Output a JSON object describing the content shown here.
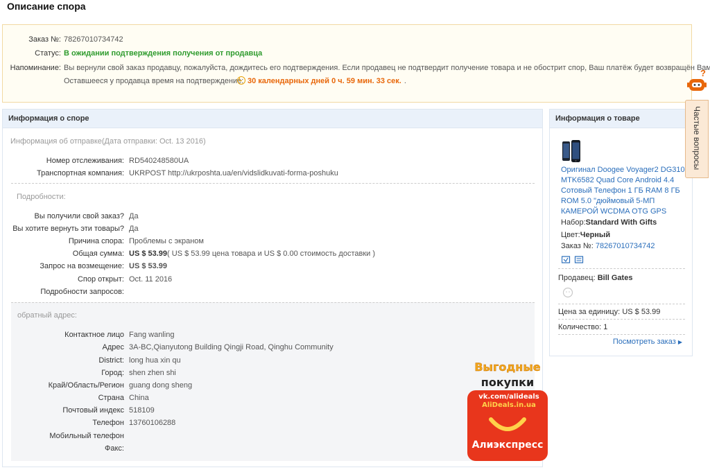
{
  "page_title": "Описание спора",
  "summary": {
    "order_label": "Заказ №:",
    "order_value": "78267010734742",
    "status_label": "Статус:",
    "status_value": "В ожидании подтверждения получения от продавца",
    "reminder_label": "Напоминание:",
    "reminder_value": "Вы вернули свой заказ продавцу, пожалуйста, дождитесь его подтверждения. Если продавец не подтвердит получение товара и не обострит спор, Ваш платёж будет возвращён Вам.",
    "time_label": "Оставшееся у продавца время на подтверждение:",
    "time_value": "30 календарных дней 0 ч. 59 мин. 33 сек.",
    "time_suffix": "."
  },
  "dispute": {
    "title": "Информация о споре",
    "shipping_head": "Информация об отправке(Дата отправки: Oct. 13 2016)",
    "tracking_label": "Номер отслеживания:",
    "tracking_value": "RD540248580UA",
    "carrier_label": "Транспортная компания:",
    "carrier_value": "UKRPOST http://ukrposhta.ua/en/vidslidkuvati-forma-poshuku",
    "details_head": "Подробности:",
    "received_label": "Вы получили свой заказ?",
    "received_value": "Да",
    "return_label": "Вы хотите вернуть эти товары?",
    "return_value": "Да",
    "reason_label": "Причина спора:",
    "reason_value": "Проблемы с экраном",
    "total_label": "Общая сумма:",
    "total_amount": "US $ 53.99",
    "total_detail": "( US $ 53.99 цена товара и US $ 0.00 стоимость доставки )",
    "refund_label": "Запрос на возмещение:",
    "refund_value": "US $ 53.99",
    "opened_label": "Спор открыт:",
    "opened_value": "Oct. 11 2016",
    "requests_label": "Подробности запросов:",
    "address_head": "обратный адрес:",
    "address": [
      {
        "label": "Контактное лицо",
        "value": "Fang wanling"
      },
      {
        "label": "Адрес",
        "value": "3A-BC,Qianyutong Building Qingji Road, Qinghu Community"
      },
      {
        "label": "District:",
        "value": "long hua xin qu"
      },
      {
        "label": "Город:",
        "value": "shen zhen shi"
      },
      {
        "label": "Край/Область/Регион",
        "value": "guang dong sheng"
      },
      {
        "label": "Страна",
        "value": "China"
      },
      {
        "label": "Почтовый индекс",
        "value": "518109"
      },
      {
        "label": "Телефон",
        "value": "13760106288"
      },
      {
        "label": "Мобильный телефон",
        "value": ""
      },
      {
        "label": "Факс:",
        "value": ""
      }
    ]
  },
  "product": {
    "title": "Информация о товаре",
    "name": "Оригинал Doogee Voyager2 DG310 MTK6582 Quad Core Android 4.4 Сотовый Телефон 1 ГБ RAM 8 ГБ ROM 5.0 \"дюймовый 5-МП КАМЕРОЙ WCDMA OTG GPS",
    "set_label": "Набор:",
    "set_value": "Standard With Gifts",
    "color_label": "Цвет:",
    "color_value": "Черный",
    "order_label": "Заказ №:",
    "order_value": "78267010734742",
    "seller_label": "Продавец:",
    "seller_value": "Bill Gates",
    "price_label": "Цена за единицу:",
    "price_value": "US $ 53.99",
    "qty_label": "Количество:",
    "qty_value": "1",
    "view_order": "Посмотреть заказ"
  },
  "faq_label": "Частые вопросы",
  "promo": {
    "line1": "Выгодные",
    "line2": "покупки",
    "url1": "vk.com/alideals",
    "url2": "AliDeals.in.ua",
    "brand": "Алиэкспресс"
  },
  "colors": {
    "accent_link": "#2a6ebb",
    "status_green": "#2e9b2e",
    "price_orange": "#e8670a",
    "promo_red": "#e8361c"
  }
}
